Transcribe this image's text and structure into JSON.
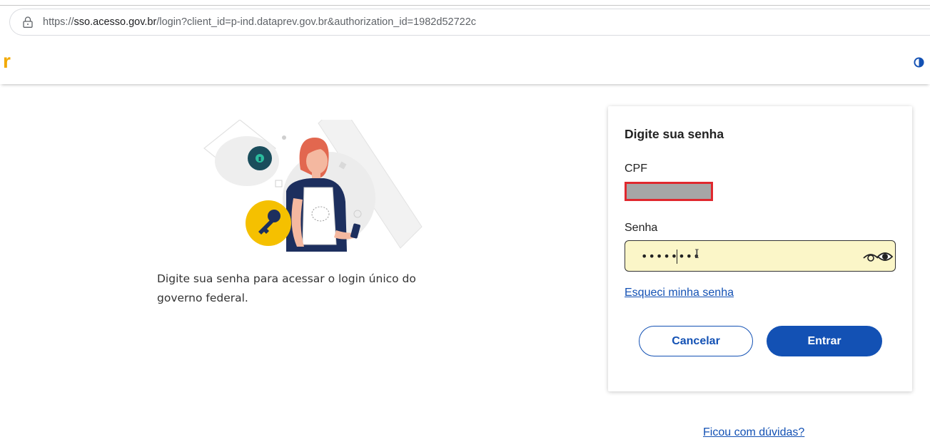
{
  "browser": {
    "url_prefix": "https://",
    "url_host": "sso.acesso.gov.br",
    "url_rest": "/login?client_id=p-ind.dataprev.gov.br&authorization_id=1982d52722c"
  },
  "header": {
    "logo_fragment": "r",
    "contrast_icon": "contrast-icon"
  },
  "intro": {
    "text": "Digite sua senha para acessar o login único do governo federal."
  },
  "form": {
    "title": "Digite sua senha",
    "cpf_label": "CPF",
    "password_label": "Senha",
    "password_value": "••••••••",
    "forgot_link": "Esqueci minha senha",
    "cancel_label": "Cancelar",
    "submit_label": "Entrar"
  },
  "footer": {
    "help_link": "Ficou com dúvidas?"
  },
  "colors": {
    "primary": "#1351b4",
    "logo": "#f2a900",
    "field_highlight": "#fbf6c8",
    "redaction_border": "#e0282e",
    "redaction_fill": "#a6a6a6"
  }
}
